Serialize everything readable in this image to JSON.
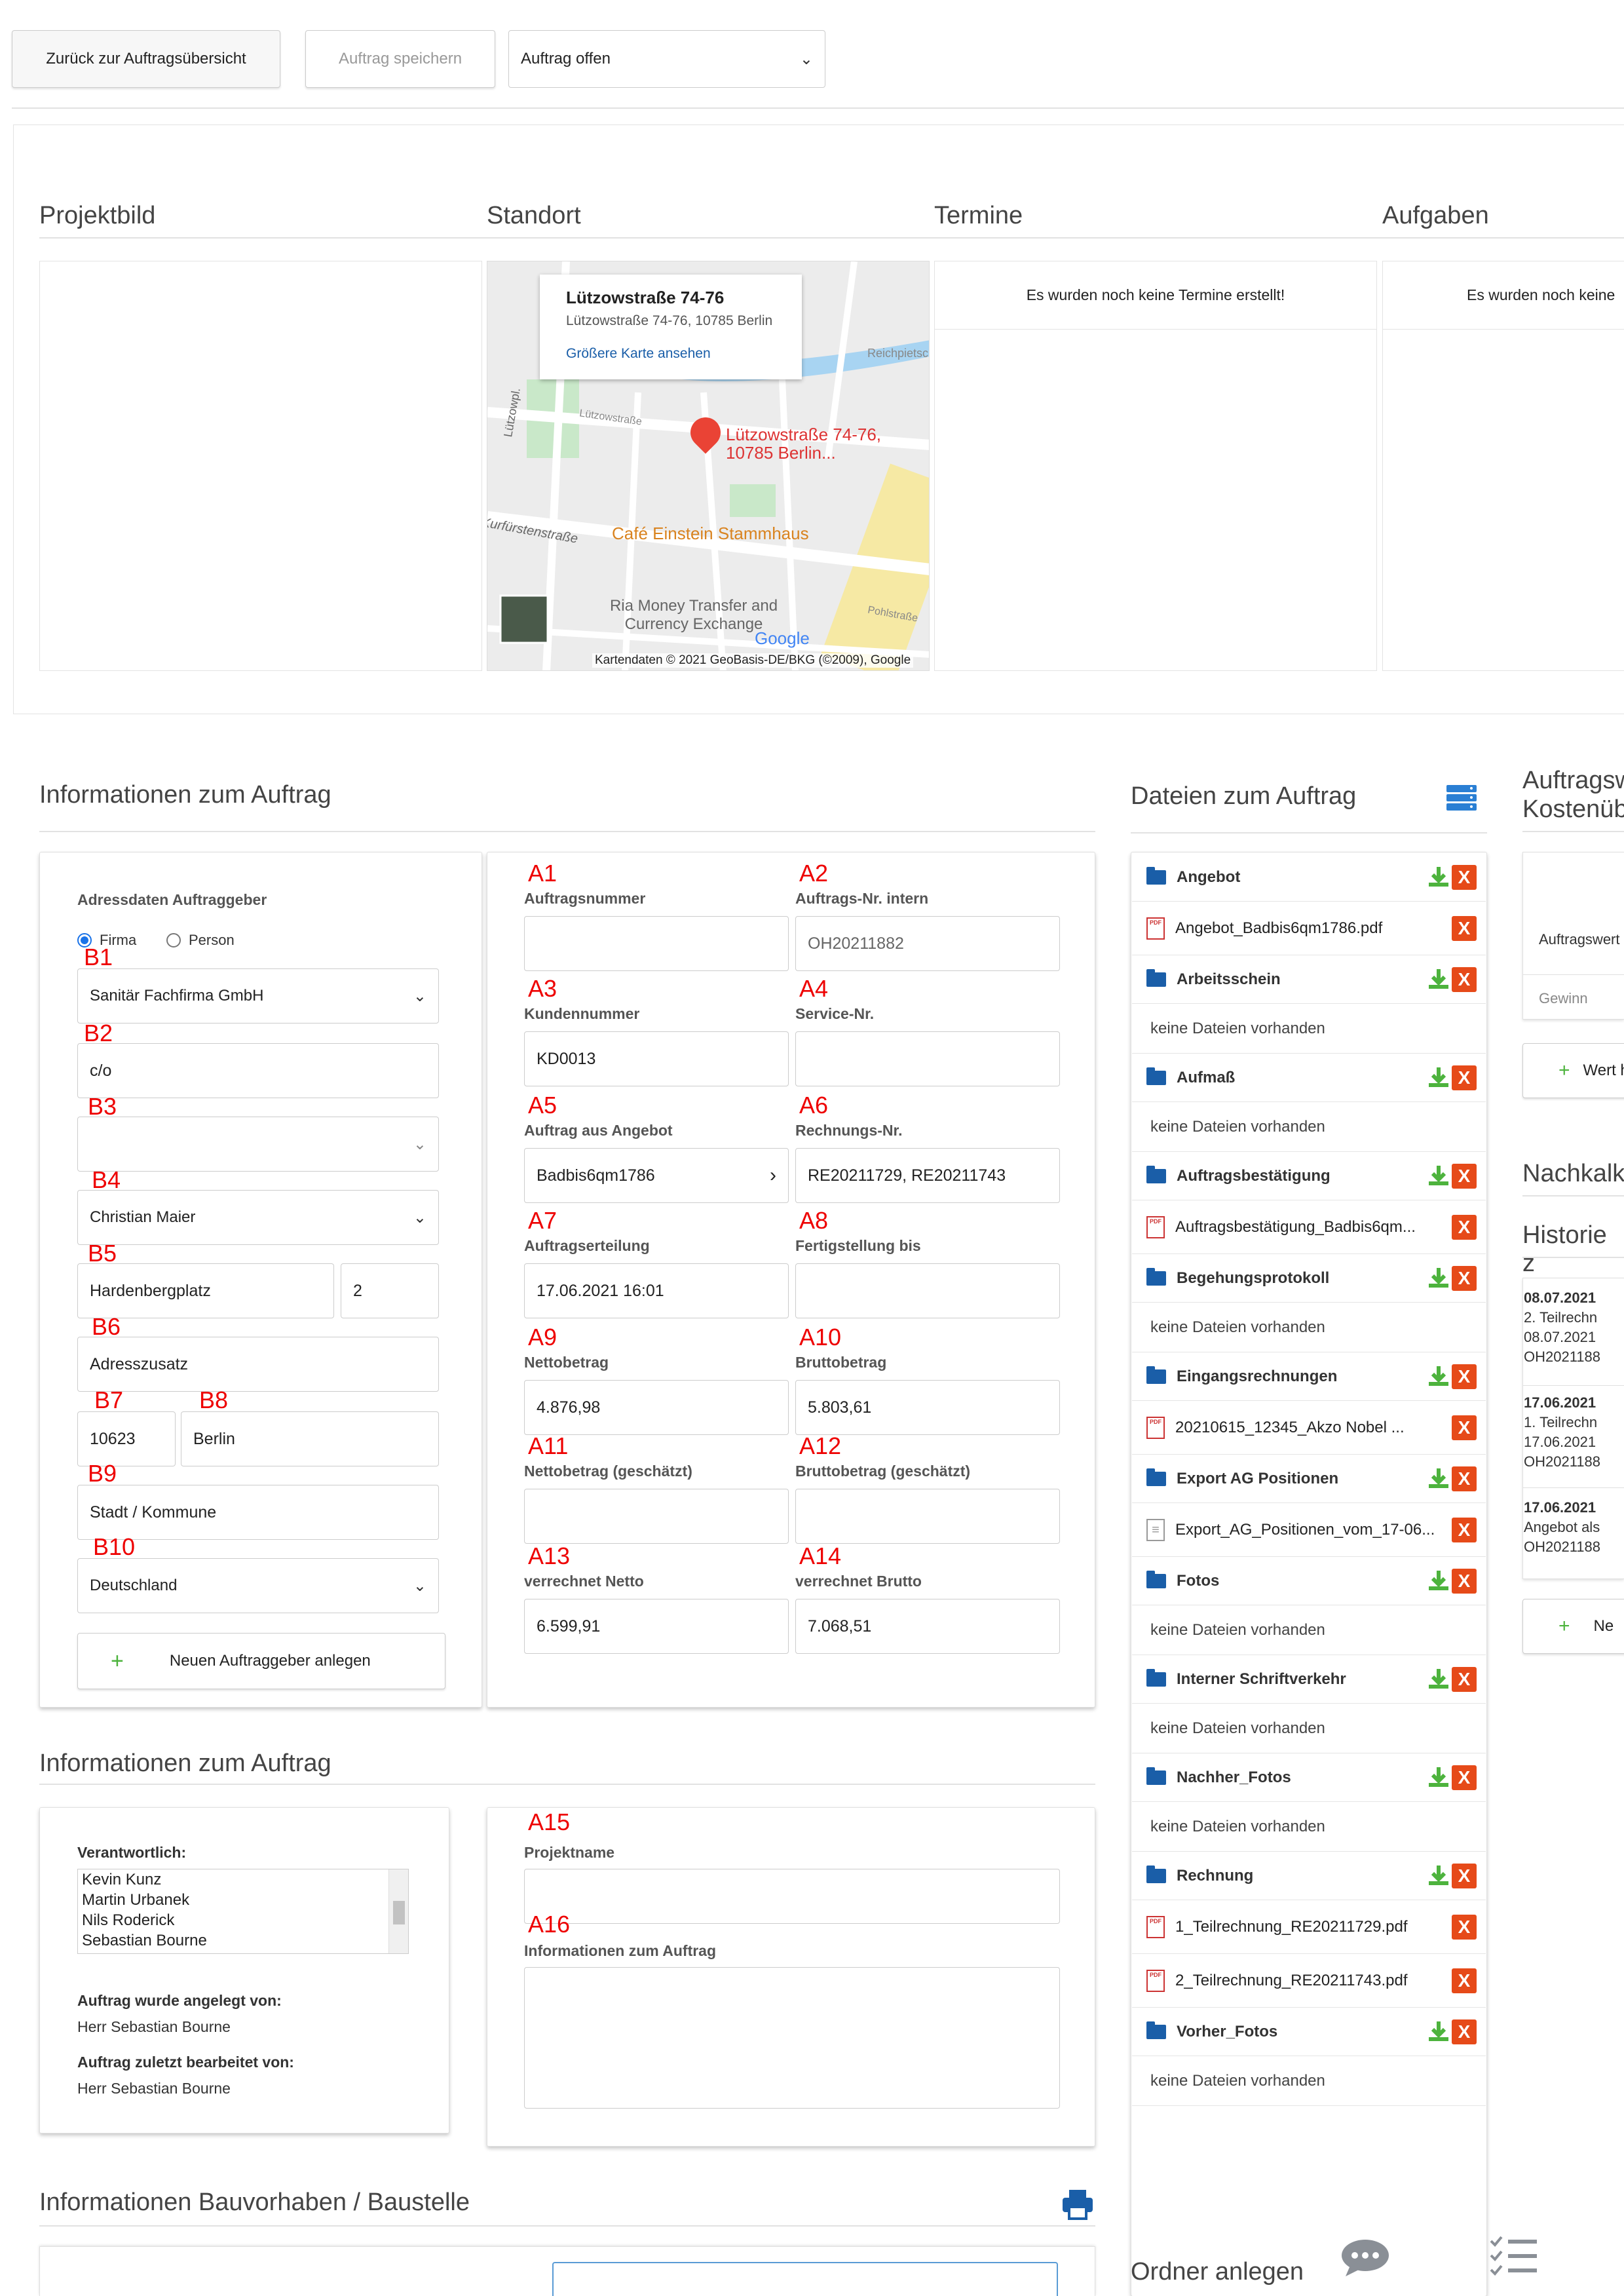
{
  "toolbar": {
    "back": "Zurück zur Auftragsübersicht",
    "save": "Auftrag speichern",
    "status": "Auftrag offen"
  },
  "top_sections": {
    "projektbild": "Projektbild",
    "standort": "Standort",
    "termine": "Termine",
    "aufgaben": "Aufgaben",
    "termine_empty": "Es wurden noch keine Termine erstellt!",
    "aufgaben_empty": "Es wurden noch keine"
  },
  "map": {
    "place_title": "Lützowstraße 74-76",
    "place_address": "Lützowstraße 74-76, 10785 Berlin",
    "larger_map": "Größere Karte ansehen",
    "pin_label": "Lützowstraße 74-76, 10785 Berlin...",
    "cafe": "Café Einstein Stammhaus",
    "ria": "Ria Money Transfer and Currency Exchange",
    "google": "Google",
    "attribution": "Kartendaten © 2021 GeoBasis-DE/BKG (©2009), Google",
    "street1": "Lützowstraße",
    "street2": "Kurfürstenstraße",
    "street3": "Pohlstraße",
    "street4": "Reichpietschufer",
    "street5": "Lützowpl."
  },
  "info_auftrag": {
    "title": "Informationen zum Auftrag",
    "client_title": "Adressdaten Auftraggeber",
    "radio_firma": "Firma",
    "radio_person": "Person",
    "company": "Sanitär Fachfirma GmbH",
    "co": "c/o",
    "contact": "Christian Maier",
    "street": "Hardenbergplatz",
    "house_no": "2",
    "addr_extra_ph": "Adresszusatz",
    "zip": "10623",
    "city": "Berlin",
    "municipality_ph": "Stadt / Kommune",
    "country": "Deutschland",
    "new_client": "Neuen Auftraggeber anlegen",
    "markers_b": [
      "B1",
      "B2",
      "B3",
      "B4",
      "B5",
      "B6",
      "B7",
      "B8",
      "B9",
      "B10"
    ],
    "fields": [
      {
        "marker": "A1",
        "label": "Auftragsnummer",
        "value": ""
      },
      {
        "marker": "A2",
        "label": "Auftrags-Nr. intern",
        "value": "OH20211882"
      },
      {
        "marker": "A3",
        "label": "Kundennummer",
        "value": "KD0013"
      },
      {
        "marker": "A4",
        "label": "Service-Nr.",
        "value": ""
      },
      {
        "marker": "A5",
        "label": "Auftrag aus Angebot",
        "value": "Badbis6qm1786"
      },
      {
        "marker": "A6",
        "label": "Rechnungs-Nr.",
        "value": "RE20211729, RE20211743"
      },
      {
        "marker": "A7",
        "label": "Auftragserteilung",
        "value": "17.06.2021 16:01"
      },
      {
        "marker": "A8",
        "label": "Fertigstellung bis",
        "value": ""
      },
      {
        "marker": "A9",
        "label": "Nettobetrag",
        "value": "4.876,98"
      },
      {
        "marker": "A10",
        "label": "Bruttobetrag",
        "value": "5.803,61"
      },
      {
        "marker": "A11",
        "label": "Nettobetrag (geschätzt)",
        "value": ""
      },
      {
        "marker": "A12",
        "label": "Bruttobetrag (geschätzt)",
        "value": ""
      },
      {
        "marker": "A13",
        "label": "verrechnet Netto",
        "value": "6.599,91"
      },
      {
        "marker": "A14",
        "label": "verrechnet Brutto",
        "value": "7.068,51"
      }
    ]
  },
  "info_auftrag2": {
    "title": "Informationen zum Auftrag",
    "responsible_label": "Verantwortlich:",
    "responsible": [
      "Kevin Kunz",
      "Martin Urbanek",
      "Nils Roderick",
      "Sebastian Bourne"
    ],
    "created_by_label": "Auftrag wurde angelegt von:",
    "created_by": "Herr Sebastian Bourne",
    "edited_by_label": "Auftrag zuletzt bearbeitet von:",
    "edited_by": "Herr Sebastian Bourne",
    "a15": "A15",
    "project_name_label": "Projektname",
    "a16": "A16",
    "info_label": "Informationen zum Auftrag"
  },
  "bauvorhaben": {
    "title": "Informationen Bauvorhaben / Baustelle"
  },
  "files": {
    "title": "Dateien zum Auftrag",
    "empty": "keine Dateien vorhanden",
    "rows": [
      {
        "type": "folder",
        "name": "Angebot"
      },
      {
        "type": "pdf",
        "name": "Angebot_Badbis6qm1786.pdf"
      },
      {
        "type": "folder",
        "name": "Arbeitsschein"
      },
      {
        "type": "empty",
        "name": "keine Dateien vorhanden"
      },
      {
        "type": "folder",
        "name": "Aufmaß"
      },
      {
        "type": "empty",
        "name": "keine Dateien vorhanden"
      },
      {
        "type": "folder",
        "name": "Auftragsbestätigung"
      },
      {
        "type": "pdf",
        "name": "Auftragsbestätigung_Badbis6qm..."
      },
      {
        "type": "folder",
        "name": "Begehungsprotokoll"
      },
      {
        "type": "empty",
        "name": "keine Dateien vorhanden"
      },
      {
        "type": "folder",
        "name": "Eingangsrechnungen"
      },
      {
        "type": "pdf",
        "name": "20210615_12345_Akzo Nobel ..."
      },
      {
        "type": "folder",
        "name": "Export AG Positionen"
      },
      {
        "type": "doc",
        "name": "Export_AG_Positionen_vom_17-06..."
      },
      {
        "type": "folder",
        "name": "Fotos"
      },
      {
        "type": "empty",
        "name": "keine Dateien vorhanden"
      },
      {
        "type": "folder",
        "name": "Interner Schriftverkehr"
      },
      {
        "type": "empty",
        "name": "keine Dateien vorhanden"
      },
      {
        "type": "folder",
        "name": "Nachher_Fotos"
      },
      {
        "type": "empty",
        "name": "keine Dateien vorhanden"
      },
      {
        "type": "folder",
        "name": "Rechnung"
      },
      {
        "type": "pdf",
        "name": "1_Teilrechnung_RE20211729.pdf"
      },
      {
        "type": "pdf",
        "name": "2_Teilrechnung_RE20211743.pdf"
      },
      {
        "type": "folder",
        "name": "Vorher_Fotos"
      },
      {
        "type": "empty",
        "name": "keine Dateien vorhanden"
      }
    ],
    "new_folder": "Ordner anlegen"
  },
  "right_col": {
    "title1": "Auftragsw",
    "title2": "Kostenüb",
    "wert": "Auftragswert",
    "gewinn": "Gewinn",
    "add_value": "Wert h",
    "nachkalk": "Nachkalk",
    "historie": "Historie z",
    "history": [
      {
        "date": "08.07.2021",
        "l1": "2. Teilrechn",
        "l2": "08.07.2021",
        "l3": "OH2021188"
      },
      {
        "date": "17.06.2021",
        "l1": "1. Teilrechn",
        "l2": "17.06.2021",
        "l3": "OH2021188"
      },
      {
        "date": "17.06.2021",
        "l1": "Angebot als",
        "l2": "OH2021188"
      }
    ],
    "new_btn": "Ne"
  },
  "icons": [
    "chevron-down-icon",
    "chevron-right-icon",
    "download-icon",
    "delete-icon",
    "folder-icon",
    "pdf-icon",
    "document-icon",
    "plus-icon",
    "print-icon",
    "server-icon",
    "chat-icon",
    "tasks-icon",
    "map-pin-icon"
  ],
  "colors": {
    "accent": "#1a5ea8",
    "delete": "#e64a19",
    "download": "#4db33d",
    "marker": "#e00000"
  }
}
